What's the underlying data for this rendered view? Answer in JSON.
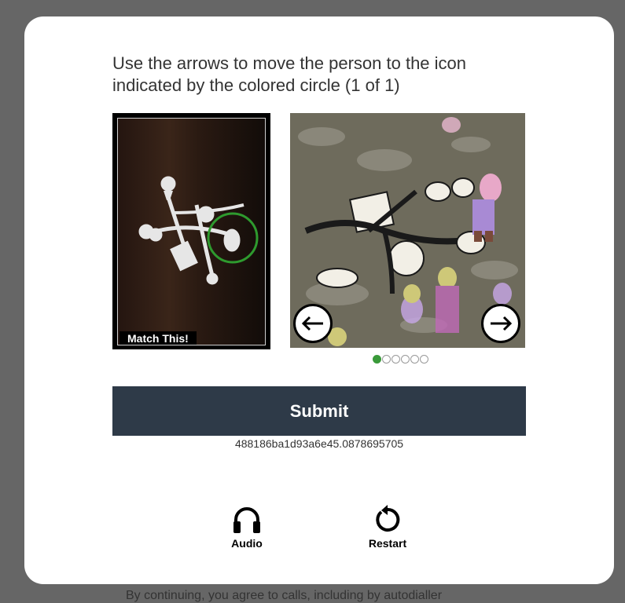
{
  "background": {
    "text": "By continuing, you agree to calls, including by autodialler"
  },
  "instructions": {
    "line1": "Use the arrows to move the person to the icon",
    "line2": "indicated by the colored circle (1 of 1)"
  },
  "target": {
    "label": "Match This!",
    "highlight_color": "#2e9a2e"
  },
  "puzzle": {
    "left_arrow_icon": "arrow-left-icon",
    "right_arrow_icon": "arrow-right-icon",
    "current_index": 1,
    "total": 6
  },
  "submit": {
    "label": "Submit",
    "color": "#2e3a48"
  },
  "session_id": "488186ba1d93a6e45.0878695705",
  "tools": {
    "audio_label": "Audio",
    "audio_icon": "headphones-icon",
    "restart_label": "Restart",
    "restart_icon": "restart-icon"
  }
}
